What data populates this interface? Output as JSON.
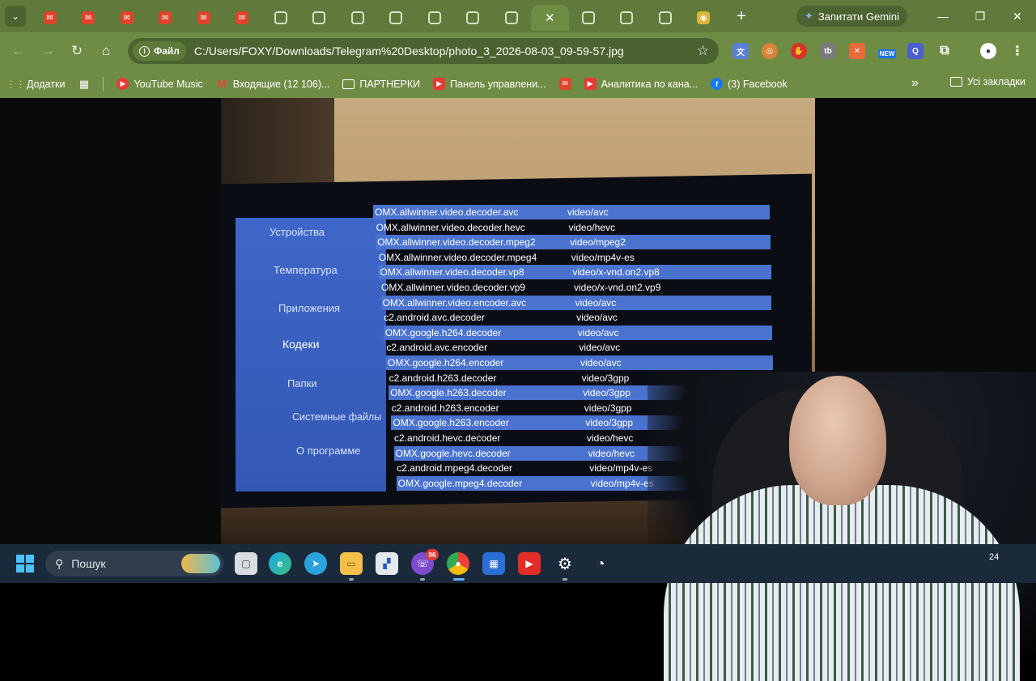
{
  "browser": {
    "tabs": [
      {
        "icon": "gmail-icon",
        "active": false
      },
      {
        "icon": "gmail-icon",
        "active": false
      },
      {
        "icon": "gmail-icon",
        "active": false
      },
      {
        "icon": "gmail-icon",
        "active": false
      },
      {
        "icon": "gmail-icon",
        "active": false
      },
      {
        "icon": "gmail-icon",
        "active": false
      },
      {
        "icon": "globe-icon",
        "active": false
      },
      {
        "icon": "globe-icon",
        "active": false
      },
      {
        "icon": "globe-icon",
        "active": false
      },
      {
        "icon": "globe-icon",
        "active": false
      },
      {
        "icon": "globe-icon",
        "active": false
      },
      {
        "icon": "globe-icon",
        "active": false
      },
      {
        "icon": "globe-icon",
        "active": false
      },
      {
        "icon": "close-icon",
        "active": true
      },
      {
        "icon": "globe-icon",
        "active": false
      },
      {
        "icon": "globe-icon",
        "active": false
      },
      {
        "icon": "globe-icon",
        "active": false
      },
      {
        "icon": "media-icon",
        "active": false
      }
    ],
    "gemini_label": "Запитати Gemini",
    "omnibox": {
      "chip_label": "Файл",
      "url": "C:/Users/FOXY/Downloads/Telegram%20Desktop/photo_3_2026-08-03_09-59-57.jpg"
    },
    "extension_new_badge": "NEW",
    "bookmarks": [
      {
        "label": "Додатки",
        "icon": "apps-grid-icon"
      },
      {
        "label": "YouTube Music",
        "icon": "youtube-music-icon"
      },
      {
        "label": "Входящие (12 106)...",
        "icon": "gmail-icon"
      },
      {
        "label": "ПАРТНЕРКИ",
        "icon": "folder-icon"
      },
      {
        "label": "Панель управлени...",
        "icon": "youtube-icon"
      },
      {
        "label": "Аналитика по кана...",
        "icon": "youtube-icon"
      },
      {
        "label": "(3) Facebook",
        "icon": "facebook-icon"
      }
    ],
    "all_bookmarks_label": "Усі закладки"
  },
  "tv_menu": {
    "items": [
      "Устройства",
      "Температура",
      "Приложения",
      "Кодеки",
      "Папки",
      "Системные файлы",
      "О программе"
    ],
    "selected": "Кодеки"
  },
  "codecs": [
    {
      "name": "OMX.allwinner.video.decoder.avc",
      "mime": "video/avc"
    },
    {
      "name": "OMX.allwinner.video.decoder.hevc",
      "mime": "video/hevc"
    },
    {
      "name": "OMX.allwinner.video.decoder.mpeg2",
      "mime": "video/mpeg2"
    },
    {
      "name": "OMX.allwinner.video.decoder.mpeg4",
      "mime": "video/mp4v-es"
    },
    {
      "name": "OMX.allwinner.video.decoder.vp8",
      "mime": "video/x-vnd.on2.vp8"
    },
    {
      "name": "OMX.allwinner.video.decoder.vp9",
      "mime": "video/x-vnd.on2.vp9"
    },
    {
      "name": "OMX.allwinner.video.encoder.avc",
      "mime": "video/avc"
    },
    {
      "name": "c2.android.avc.decoder",
      "mime": "video/avc"
    },
    {
      "name": "OMX.google.h264.decoder",
      "mime": "video/avc"
    },
    {
      "name": "c2.android.avc.encoder",
      "mime": "video/avc"
    },
    {
      "name": "OMX.google.h264.encoder",
      "mime": "video/avc"
    },
    {
      "name": "c2.android.h263.decoder",
      "mime": "video/3gpp"
    },
    {
      "name": "OMX.google.h263.decoder",
      "mime": "video/3gpp"
    },
    {
      "name": "c2.android.h263.encoder",
      "mime": "video/3gpp"
    },
    {
      "name": "OMX.google.h263.encoder",
      "mime": "video/3gpp"
    },
    {
      "name": "c2.android.hevc.decoder",
      "mime": "video/hevc"
    },
    {
      "name": "OMX.google.hevc.decoder",
      "mime": "video/hevc"
    },
    {
      "name": "c2.android.mpeg4.decoder",
      "mime": "video/mp4v-es"
    },
    {
      "name": "OMX.google.mpeg4.decoder",
      "mime": "video/mp4v-es"
    }
  ],
  "taskbar": {
    "search_placeholder": "Пошук",
    "viber_badge": "96",
    "clock_fragment": "24"
  },
  "colors": {
    "browser_theme": "#6f8c45",
    "tab_strip": "#5f7a3a",
    "tv_menu_blue": "#3f67c9",
    "codec_row_band": "#4a73cf",
    "taskbar": "#1b2a3a"
  }
}
